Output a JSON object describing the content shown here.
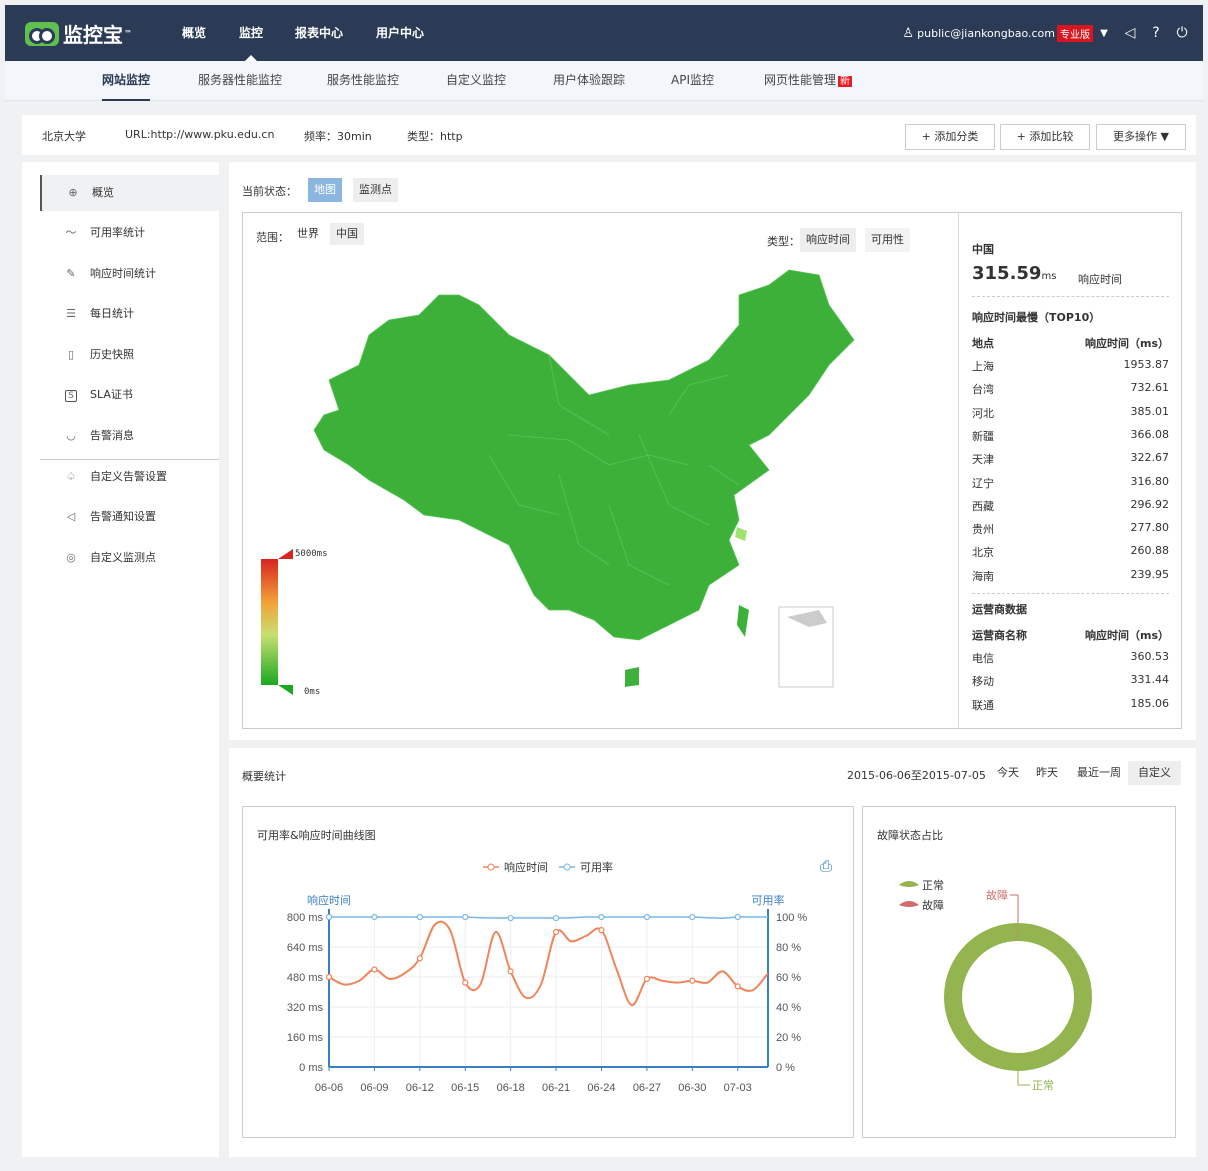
{
  "brand": {
    "name": "监控宝",
    "tm": "™"
  },
  "topnav": [
    {
      "label": "概览"
    },
    {
      "label": "监控",
      "active": true
    },
    {
      "label": "报表中心"
    },
    {
      "label": "用户中心"
    }
  ],
  "user": {
    "email": "public@jiankongbao.com",
    "badge": "专业版"
  },
  "subnav": {
    "items": [
      "网站监控",
      "服务器性能监控",
      "服务性能监控",
      "自定义监控",
      "用户体验跟踪",
      "API监控",
      "网页性能管理"
    ],
    "new_badge": "新"
  },
  "info": {
    "name": "北京大学",
    "url": "URL:http://www.pku.edu.cn",
    "freq": "频率：30min",
    "type": "类型：http",
    "btn_add_category": "+ 添加分类",
    "btn_add_compare": "+ 添加比较",
    "btn_more": "更多操作 ▼"
  },
  "sidebar": {
    "items": [
      {
        "label": "概览",
        "icon": "globe-icon",
        "glyph": "⊕"
      },
      {
        "label": "可用率统计",
        "icon": "trend-icon",
        "glyph": "〜"
      },
      {
        "label": "响应时间统计",
        "icon": "edit-icon",
        "glyph": "✎"
      },
      {
        "label": "每日统计",
        "icon": "list-icon",
        "glyph": "☰"
      },
      {
        "label": "历史快照",
        "icon": "file-icon",
        "glyph": "▯"
      },
      {
        "label": "SLA证书",
        "icon": "sla-icon",
        "glyph": "S"
      },
      {
        "label": "告警消息",
        "icon": "cup-icon",
        "glyph": "◡"
      },
      {
        "label": "自定义告警设置",
        "icon": "bell-icon",
        "glyph": "♤"
      },
      {
        "label": "告警通知设置",
        "icon": "speaker-icon",
        "glyph": "◁"
      },
      {
        "label": "自定义监测点",
        "icon": "location-icon",
        "glyph": "◎"
      }
    ]
  },
  "status": {
    "label": "当前状态：",
    "tab_map": "地图",
    "tab_points": "监测点"
  },
  "map": {
    "range_label": "范围：",
    "range_world": "世界",
    "range_china": "中国",
    "type_label": "类型：",
    "type_resp": "响应时间",
    "type_avail": "可用性",
    "legend_max": "5000ms",
    "legend_min": "0ms",
    "fill_color": "#3db03a",
    "hot_color": "#9ee36f"
  },
  "stats": {
    "region": "中国",
    "resp_value": "315.59",
    "resp_unit": "ms",
    "resp_label": "响应时间",
    "slowest_title": "响应时间最慢（TOP10）",
    "col_place": "地点",
    "col_ms": "响应时间（ms）",
    "top10": [
      {
        "place": "上海",
        "v": "1953.87"
      },
      {
        "place": "台湾",
        "v": "732.61"
      },
      {
        "place": "河北",
        "v": "385.01"
      },
      {
        "place": "新疆",
        "v": "366.08"
      },
      {
        "place": "天津",
        "v": "322.67"
      },
      {
        "place": "辽宁",
        "v": "316.80"
      },
      {
        "place": "西藏",
        "v": "296.92"
      },
      {
        "place": "贵州",
        "v": "277.80"
      },
      {
        "place": "北京",
        "v": "260.88"
      },
      {
        "place": "海南",
        "v": "239.95"
      }
    ],
    "isp_title": "运营商数据",
    "col_isp": "运营商名称",
    "isp": [
      {
        "place": "电信",
        "v": "360.53"
      },
      {
        "place": "移动",
        "v": "331.44"
      },
      {
        "place": "联通",
        "v": "185.06"
      }
    ]
  },
  "summary": {
    "title": "概要统计",
    "date_range": "2015-06-06至2015-07-05",
    "ranges": [
      "今天",
      "昨天",
      "最近一周",
      "自定义"
    ]
  },
  "chart_data": [
    {
      "type": "line",
      "title": "可用率&响应时间曲线图",
      "ylabel_left": "响应时间",
      "ylabel_right": "可用率",
      "legend_position": "top-center",
      "x_ticks": [
        "06-06",
        "06-09",
        "06-12",
        "06-15",
        "06-18",
        "06-21",
        "06-24",
        "06-27",
        "06-30",
        "07-03"
      ],
      "y_left_ticks": [
        "0 ms",
        "160 ms",
        "320 ms",
        "480 ms",
        "640 ms",
        "800 ms"
      ],
      "y_right_ticks": [
        "0 %",
        "20 %",
        "40 %",
        "60 %",
        "80 %",
        "100 %"
      ],
      "ylim_left": [
        0,
        800
      ],
      "ylim_right": [
        0,
        100
      ],
      "x": [
        "06-06",
        "06-07",
        "06-08",
        "06-09",
        "06-10",
        "06-11",
        "06-12",
        "06-13",
        "06-14",
        "06-15",
        "06-16",
        "06-17",
        "06-18",
        "06-19",
        "06-20",
        "06-21",
        "06-22",
        "06-23",
        "06-24",
        "06-25",
        "06-26",
        "06-27",
        "06-28",
        "06-29",
        "06-30",
        "07-01",
        "07-02",
        "07-03",
        "07-04",
        "07-05"
      ],
      "series": [
        {
          "name": "响应时间",
          "color": "#f0845a",
          "axis": "left",
          "values": [
            480,
            440,
            460,
            520,
            470,
            500,
            580,
            760,
            730,
            450,
            440,
            720,
            510,
            370,
            440,
            720,
            670,
            700,
            730,
            520,
            330,
            470,
            460,
            450,
            460,
            450,
            510,
            430,
            410,
            500
          ]
        },
        {
          "name": "可用率",
          "color": "#7ab8e8",
          "axis": "right",
          "values": [
            100,
            100,
            100,
            100,
            100,
            100,
            100,
            100,
            100,
            100,
            99.5,
            99.3,
            99.3,
            99.3,
            99.3,
            99.3,
            99.5,
            100,
            100,
            100,
            100,
            100,
            100,
            100,
            100,
            99.5,
            99.2,
            100,
            100,
            100
          ]
        }
      ]
    },
    {
      "type": "pie",
      "title": "故障状态占比",
      "legend_position": "top-left",
      "categories": [
        "正常",
        "故障"
      ],
      "values": [
        99.9,
        0.1
      ],
      "colors": [
        "#93b44f",
        "#d36a6a"
      ]
    }
  ]
}
